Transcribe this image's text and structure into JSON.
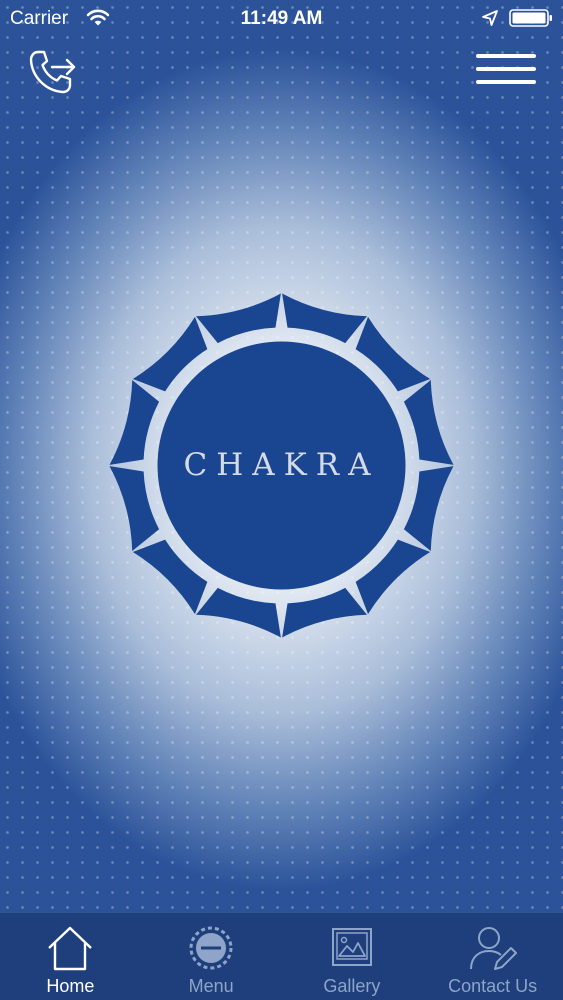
{
  "status_bar": {
    "carrier": "Carrier",
    "time": "11:49 AM"
  },
  "header": {
    "call_icon": "phone-arrow-icon",
    "menu_icon": "hamburger-menu-icon"
  },
  "logo": {
    "text": "CHAKRA",
    "color": "#1a4590"
  },
  "tabs": [
    {
      "label": "Home",
      "icon": "home-icon",
      "active": true
    },
    {
      "label": "Menu",
      "icon": "chakra-logo-icon",
      "active": false
    },
    {
      "label": "Gallery",
      "icon": "gallery-icon",
      "active": false
    },
    {
      "label": "Contact Us",
      "icon": "contact-icon",
      "active": false
    }
  ],
  "colors": {
    "tab_bar": "#1e3f7c",
    "active_label": "#ffffff",
    "inactive_label": "#8ea4c8"
  }
}
